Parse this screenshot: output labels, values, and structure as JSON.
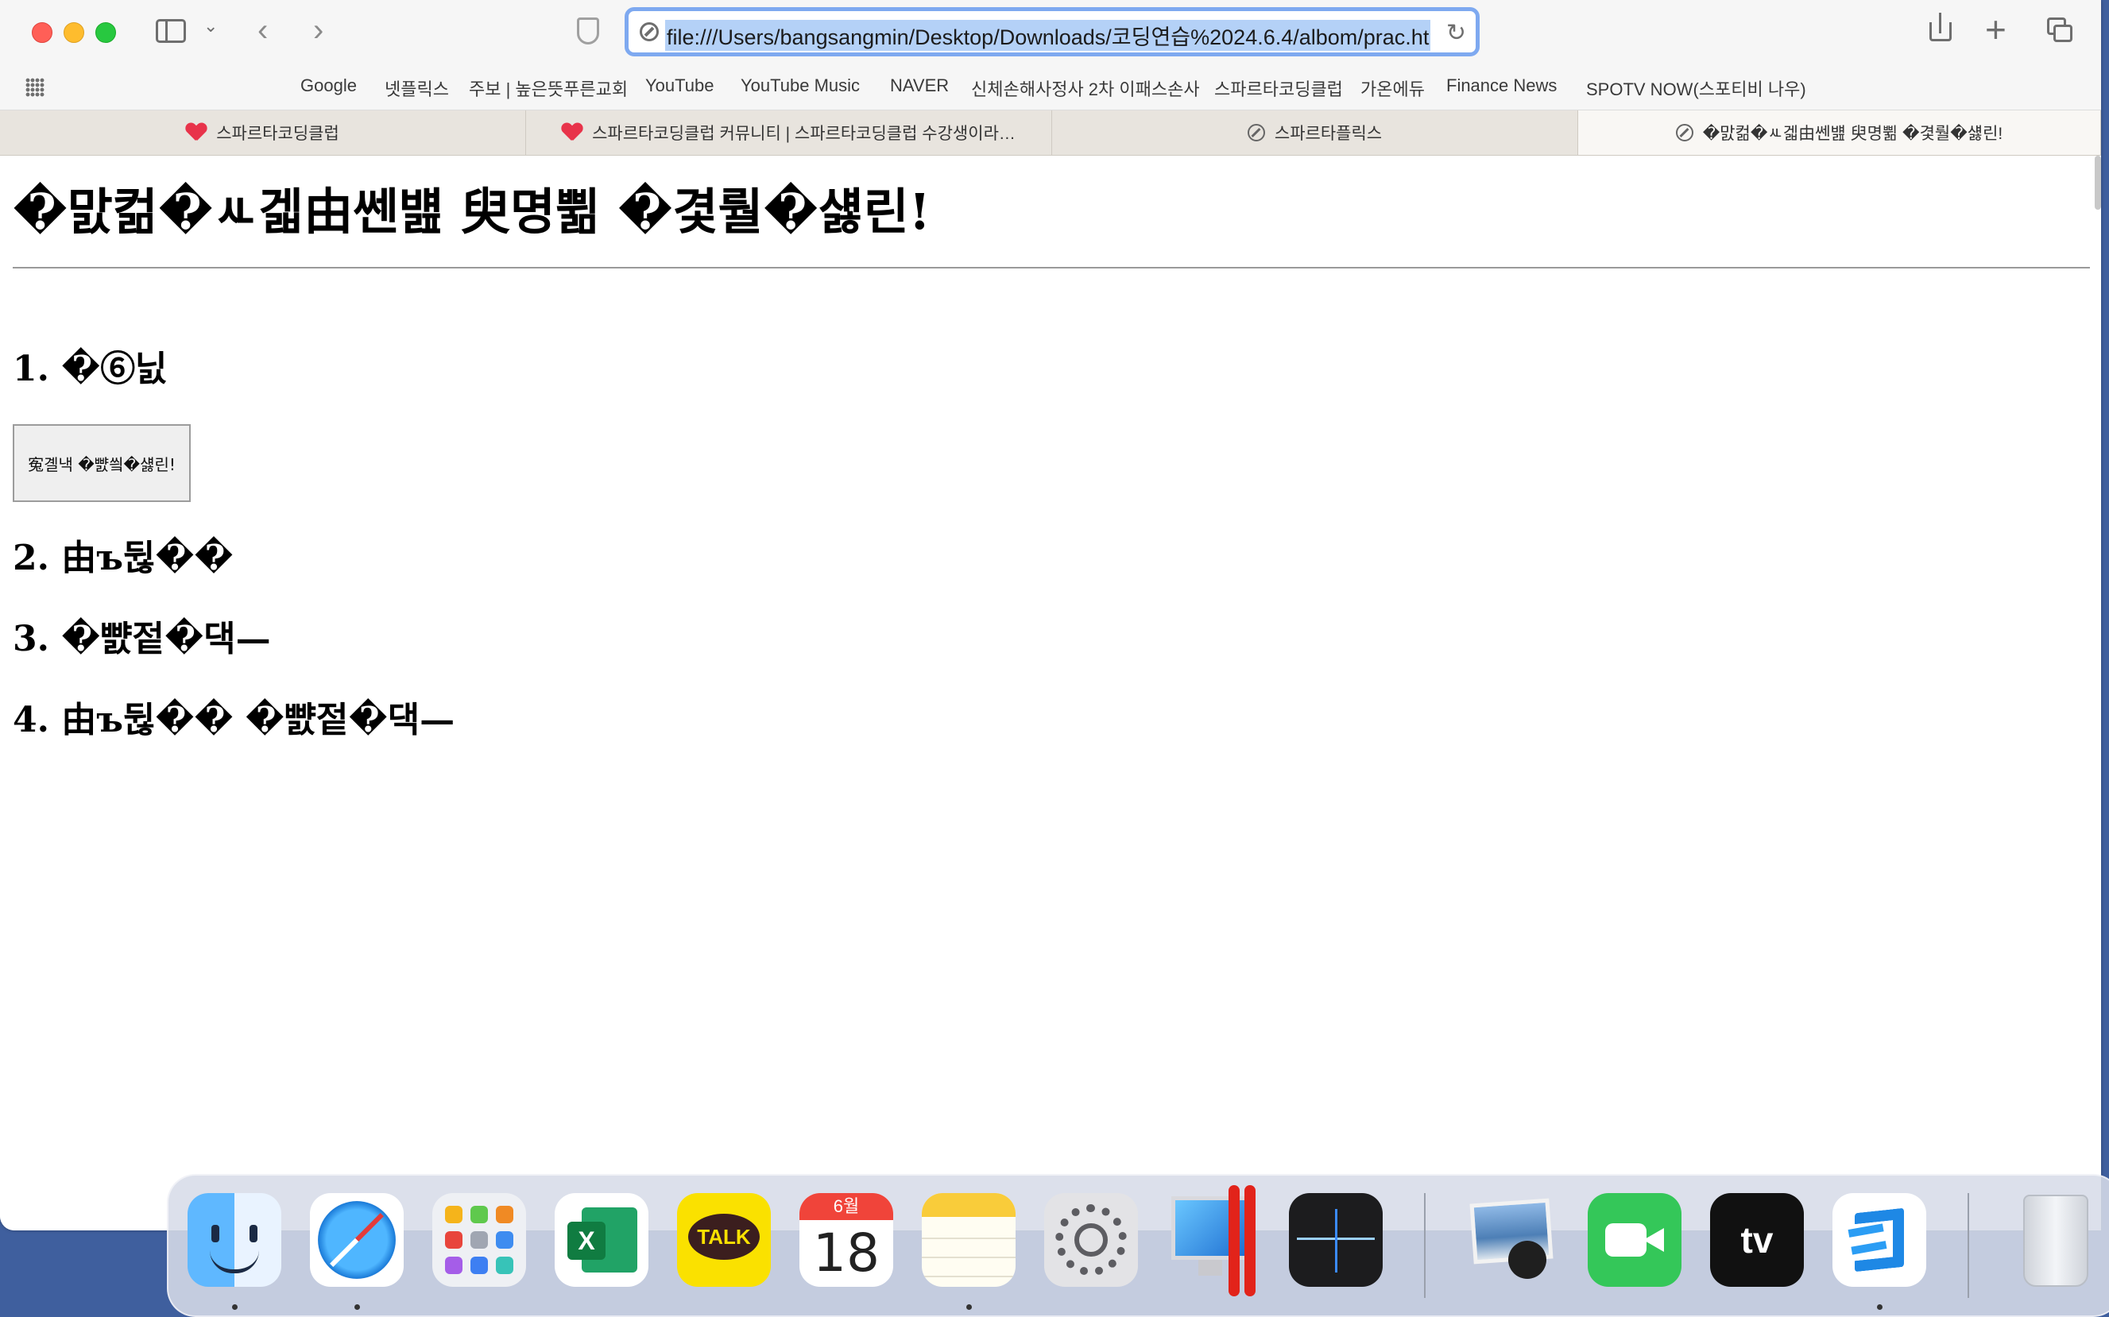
{
  "browser": {
    "url": "file:///Users/bangsangmin/Desktop/Downloads/코딩연습%2024.6.4/albom/prac.ht",
    "bookmarks": [
      "Google",
      "넷플릭스",
      "주보 | 높은뜻푸른교회",
      "YouTube",
      "YouTube Music",
      "NAVER",
      "신체손해사정사 2차 이패스손사",
      "스파르타코딩클럽",
      "가온에듀",
      "Finance News",
      "SPOTV NOW(스포티비 나우)"
    ],
    "tabs": [
      {
        "title": "스파르타코딩클럽",
        "icon": "sparta-heart-icon"
      },
      {
        "title": "스파르타코딩클럽 커뮤니티 | 스파르타코딩클럽 수강생이라…",
        "icon": "sparta-heart-icon"
      },
      {
        "title": "스파르타플릭스",
        "icon": "compass-icon"
      },
      {
        "title": "�맔컮�ㅻ겗由쎈뱶 臾명쀪 �겿뤌�섏린!",
        "icon": "compass-icon"
      }
    ],
    "active_tab": 3
  },
  "page": {
    "title": "�맔컮�ㅻ겗由쎈뱶 臾명쀪 �겿뤌�섏린!",
    "h2_1": "1. �⑥닔",
    "button_label": "寃곌낵 �뺤씤�섏린!",
    "h2_2": "2. 由ъ뒪��",
    "h2_3": "3. �뺤젙�댁—",
    "h2_4": "4. 由ъ뒪�� �뺤젙�댁—"
  },
  "dock": {
    "apps": [
      "finder-icon",
      "safari-icon",
      "launchpad-icon",
      "excel-icon",
      "kakaotalk-icon",
      "calendar-icon",
      "notes-icon",
      "system-settings-icon",
      "parallels-icon",
      "stocks-icon",
      "preview-icon",
      "facetime-icon",
      "apple-tv-icon",
      "vscode-icon",
      "trash-icon"
    ],
    "calendar_month": "6월",
    "calendar_day": "18",
    "kakao_label": "TALK",
    "excel_label": "X",
    "appletv_label": "tv"
  }
}
